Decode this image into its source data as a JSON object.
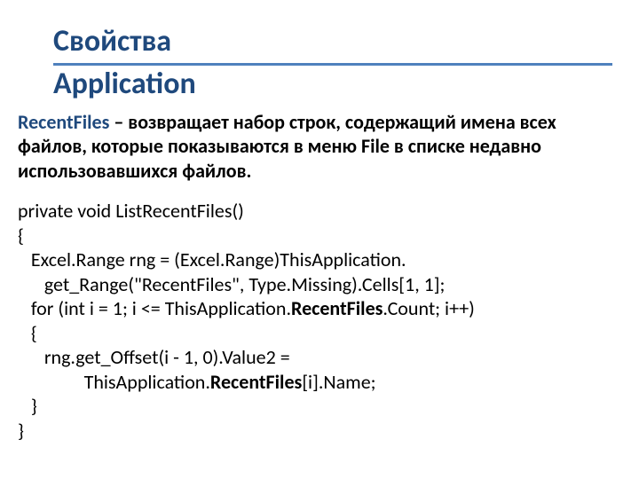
{
  "title": {
    "line1": "Свойства",
    "line2": "Application"
  },
  "description": {
    "property": "RecentFiles",
    "text": " – возвращает набор строк, содержащий имена всех файлов, которые показываются в меню File в списке недавно использовавшихся файлов."
  },
  "code": {
    "l1": "private void ListRecentFiles()",
    "l2": "{",
    "l3": "   Excel.Range rng = (Excel.Range)ThisApplication.",
    "l4": "      get_Range(\"RecentFiles\", Type.Missing).Cells[1, 1];",
    "l5a": "   for (int i = 1; i <= ThisApplication.",
    "l5b": "RecentFiles",
    "l5c": ".Count; i++)",
    "l6": "   {",
    "l7": "      rng.get_Offset(i - 1, 0).Value2 =",
    "l8a": "               ThisApplication.",
    "l8b": "RecentFiles",
    "l8c": "[i].Name;",
    "l9": "   }",
    "l10": "}"
  }
}
